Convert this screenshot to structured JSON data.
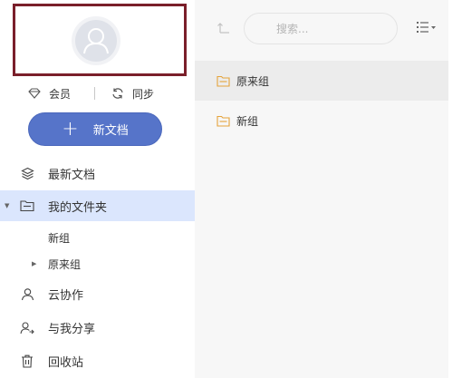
{
  "sidebar": {
    "vip_label": "会员",
    "sync_label": "同步",
    "new_doc_label": "新文档",
    "nav": {
      "recent": "最新文档",
      "my_folders": "我的文件夹",
      "coop": "云协作",
      "shared": "与我分享",
      "trash": "回收站"
    },
    "subfolders": [
      "新组",
      "原来组"
    ]
  },
  "main": {
    "search_placeholder": "搜索...",
    "folders": [
      "原来组",
      "新组"
    ]
  },
  "colors": {
    "accent": "#5674c9",
    "active_bg": "#dbe6fd",
    "folder_icon": "#e5a33b",
    "avatar_border": "#7a1f2a"
  },
  "icons": {
    "vip": "diamond-icon",
    "sync": "sync-icon",
    "recent": "layers-icon",
    "my_folders": "folder-icon",
    "coop": "user-icon",
    "shared": "share-user-icon",
    "trash": "trash-icon",
    "up": "return-up-icon",
    "view": "list-view-icon"
  }
}
